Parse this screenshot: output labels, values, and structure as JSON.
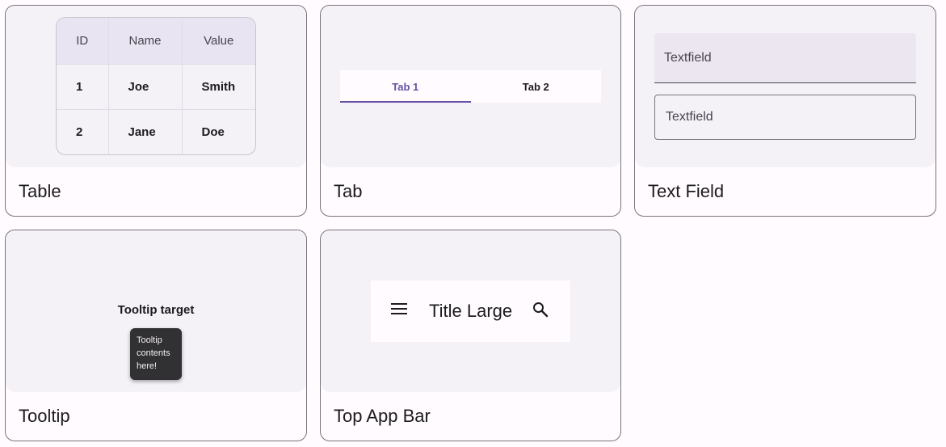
{
  "cards": {
    "table": {
      "label": "Table",
      "headers": [
        "ID",
        "Name",
        "Value"
      ],
      "rows": [
        [
          "1",
          "Joe",
          "Smith"
        ],
        [
          "2",
          "Jane",
          "Doe"
        ]
      ]
    },
    "tab": {
      "label": "Tab",
      "tabs": [
        "Tab 1",
        "Tab 2"
      ],
      "selected": "Tab 1"
    },
    "text_field": {
      "label": "Text Field",
      "filled_placeholder": "Textfield",
      "outlined_placeholder": "Textfield"
    },
    "tooltip": {
      "label": "Tooltip",
      "target_text": "Tooltip target",
      "tooltip_lines": [
        "Tooltip",
        "contents",
        "here!"
      ]
    },
    "top_app_bar": {
      "label": "Top App Bar",
      "title": "Title Large",
      "nav_icon": "menu-icon",
      "action_icon": "search-icon"
    }
  },
  "colors": {
    "accent": "#6750a4",
    "preview_bg": "#f4f1f7",
    "outline": "#79747e"
  }
}
